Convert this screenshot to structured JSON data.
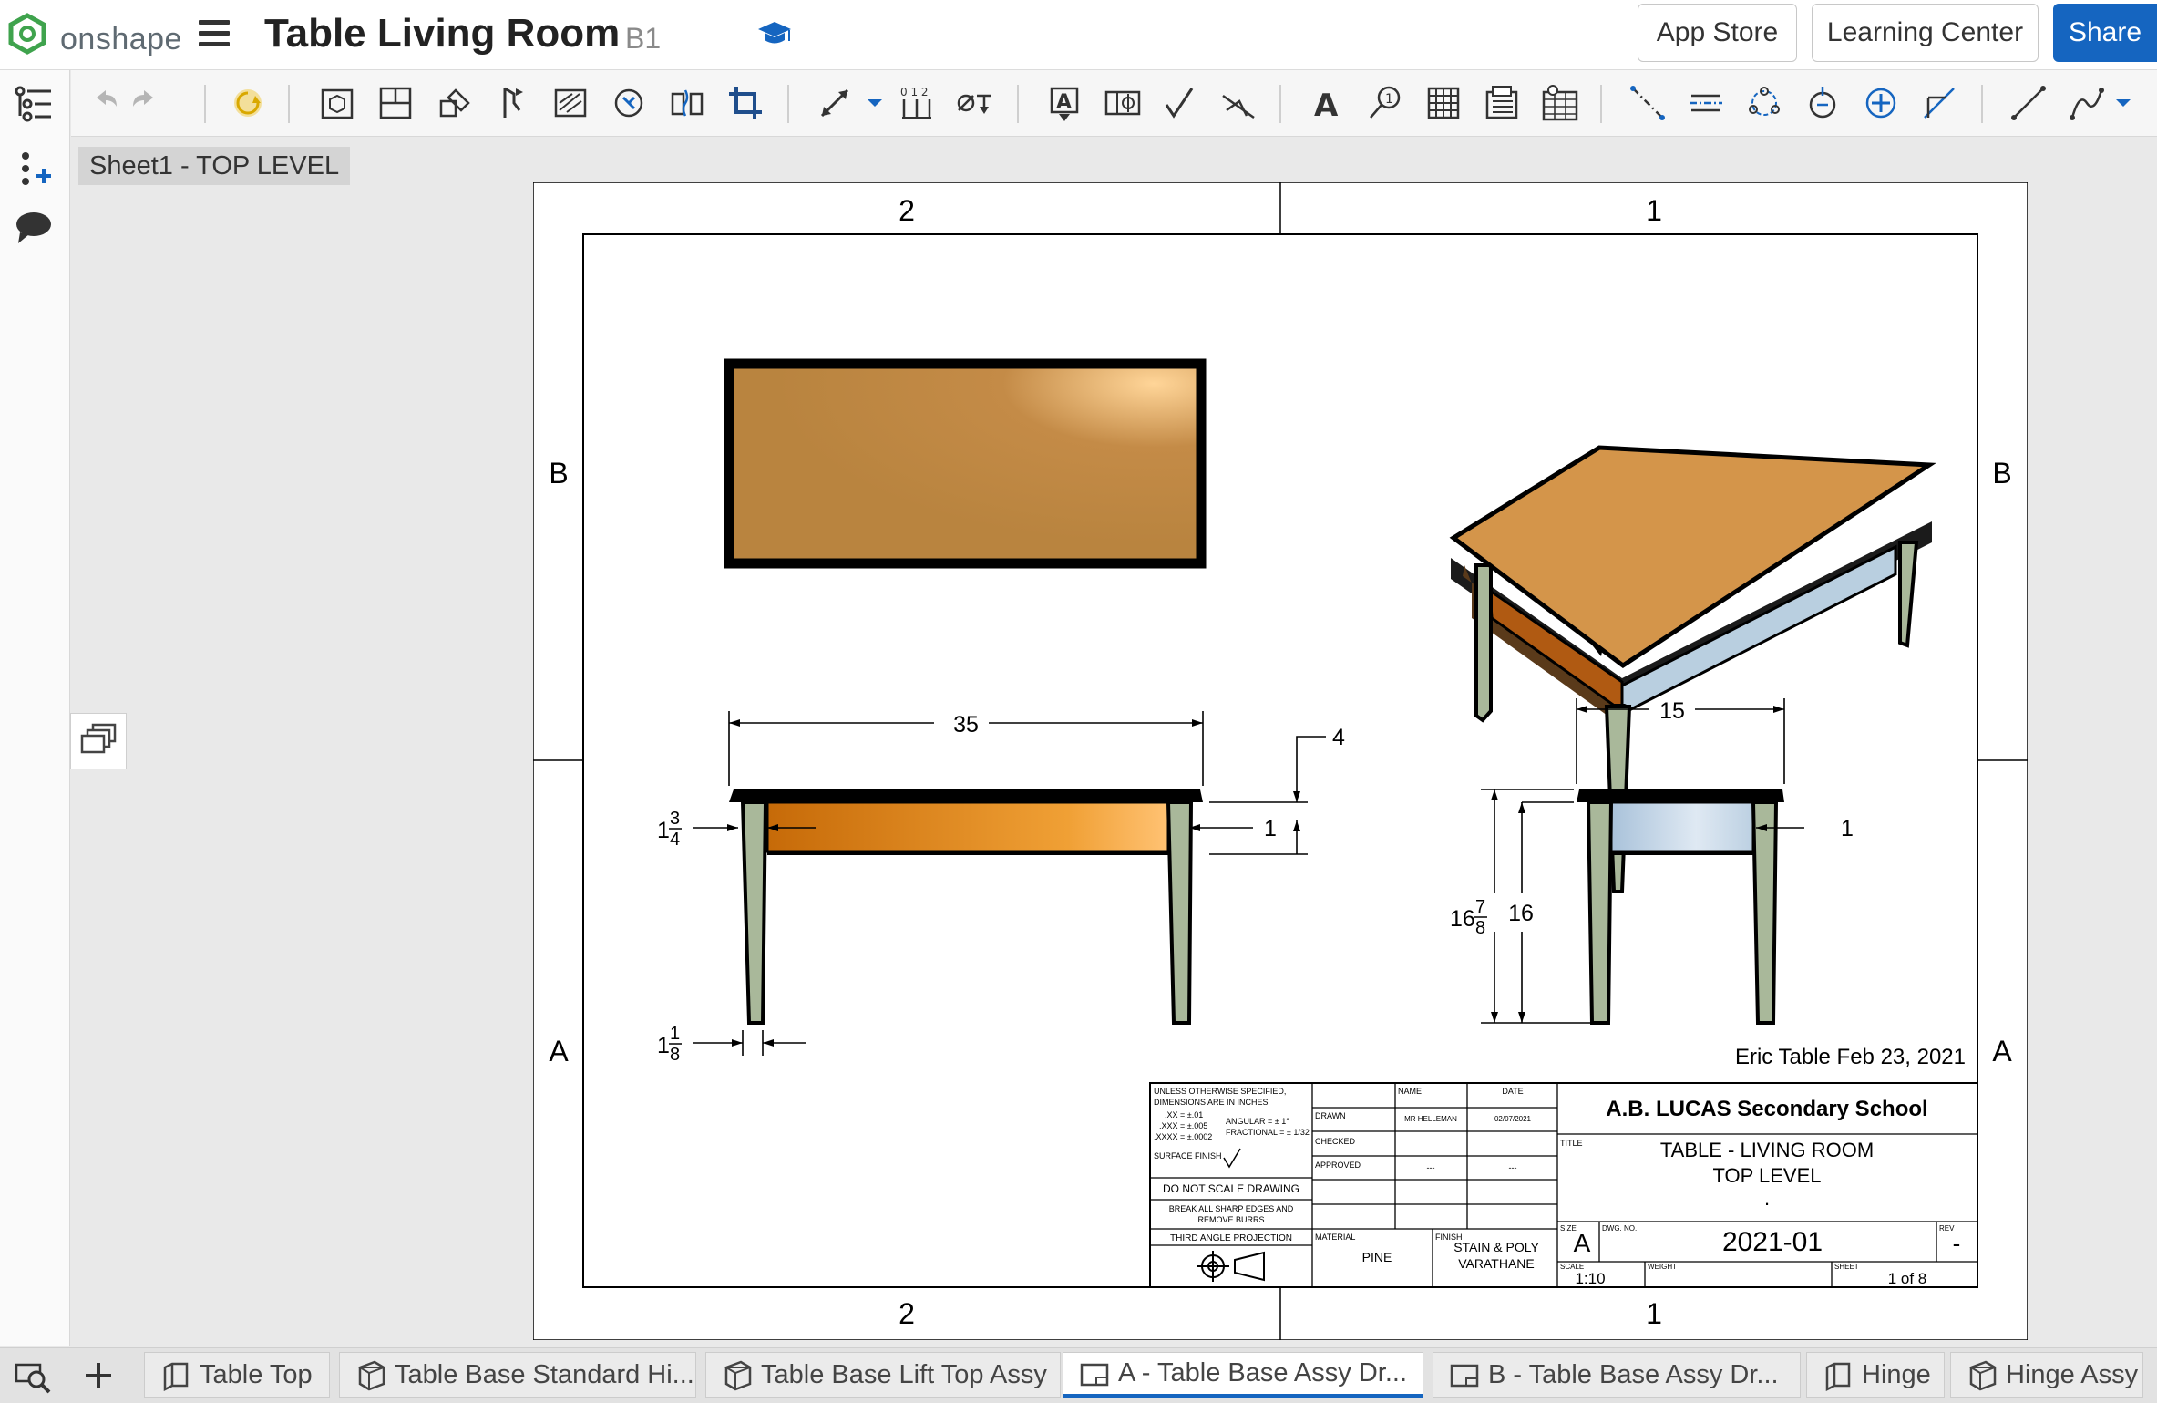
{
  "app": {
    "logo_text": "onshape"
  },
  "document": {
    "title": "Table Living Room",
    "branch": "B1"
  },
  "header_buttons": {
    "app_store": "App Store",
    "learning_center": "Learning Center",
    "share": "Share"
  },
  "sheet_label": "Sheet1 - TOP LEVEL",
  "drawing": {
    "zones": {
      "col_left": "2",
      "col_right": "1",
      "row_top": "B",
      "row_bottom": "A"
    },
    "dims": {
      "top_length": "35",
      "top_thickness": "4",
      "apron_left": "1",
      "apron_right_small": "1",
      "top_depth": "15",
      "overall_height_whole": "16",
      "overall_height_num": "7",
      "overall_height_den": "8",
      "leg_height": "16",
      "apron_width_whole": "1",
      "apron_width_num": "3",
      "apron_width_den": "4",
      "leg_width_whole": "1",
      "leg_width_num": "1",
      "leg_width_den": "8"
    },
    "note": "Eric Table Feb 23, 2021",
    "title_block": {
      "tolerance_lines": [
        "UNLESS OTHERWISE SPECIFIED,",
        "DIMENSIONS ARE IN INCHES",
        ".XX = ±.01",
        ".XXX = ±.005",
        ".XXXX = ±.0002",
        "ANGULAR = ± 1°",
        "FRACTIONAL = ± 1/32",
        "SURFACE FINISH"
      ],
      "do_not_scale": "DO NOT SCALE DRAWING",
      "break_edges_1": "BREAK ALL SHARP EDGES AND",
      "break_edges_2": "REMOVE BURRS",
      "projection": "THIRD ANGLE PROJECTION",
      "name_header": "NAME",
      "date_header": "DATE",
      "drawn_label": "DRAWN",
      "drawn_name": "MR HELLEMAN",
      "drawn_date": "02/07/2021",
      "checked_label": "CHECKED",
      "approved_label": "APPROVED",
      "approved_name": "---",
      "approved_date": "---",
      "material_label": "MATERIAL",
      "material": "PINE",
      "finish_label": "FINISH",
      "finish_1": "STAIN & POLY",
      "finish_2": "VARATHANE",
      "company": "A.B. LUCAS Secondary School",
      "title_label": "TITLE",
      "title_1": "TABLE - LIVING ROOM",
      "title_2": "TOP LEVEL",
      "title_3": ".",
      "size_label": "SIZE",
      "size": "A",
      "dwg_label": "DWG. NO.",
      "dwg_no": "2021-01",
      "rev_label": "REV",
      "rev": "-",
      "scale_label": "SCALE",
      "scale": "1:10",
      "weight_label": "WEIGHT",
      "sheet_label": "SHEET",
      "sheet": "1 of 8"
    }
  },
  "tabs": [
    {
      "label": "Table Top",
      "icon": "part-studio-icon"
    },
    {
      "label": "Table Base Standard Hi...",
      "icon": "assembly-icon"
    },
    {
      "label": "Table Base Lift Top Assy",
      "icon": "assembly-icon"
    },
    {
      "label": "A - Table Base Assy Dr...",
      "icon": "drawing-icon",
      "active": true
    },
    {
      "label": "B - Table Base Assy Dr...",
      "icon": "drawing-icon"
    },
    {
      "label": "Hinge",
      "icon": "part-studio-icon"
    },
    {
      "label": "Hinge Assy",
      "icon": "assembly-icon"
    }
  ],
  "colors": {
    "accent": "#1565c0",
    "wood": "#c7893f",
    "leg": "#a9b89a",
    "apron_light": "#b9cfe0"
  }
}
